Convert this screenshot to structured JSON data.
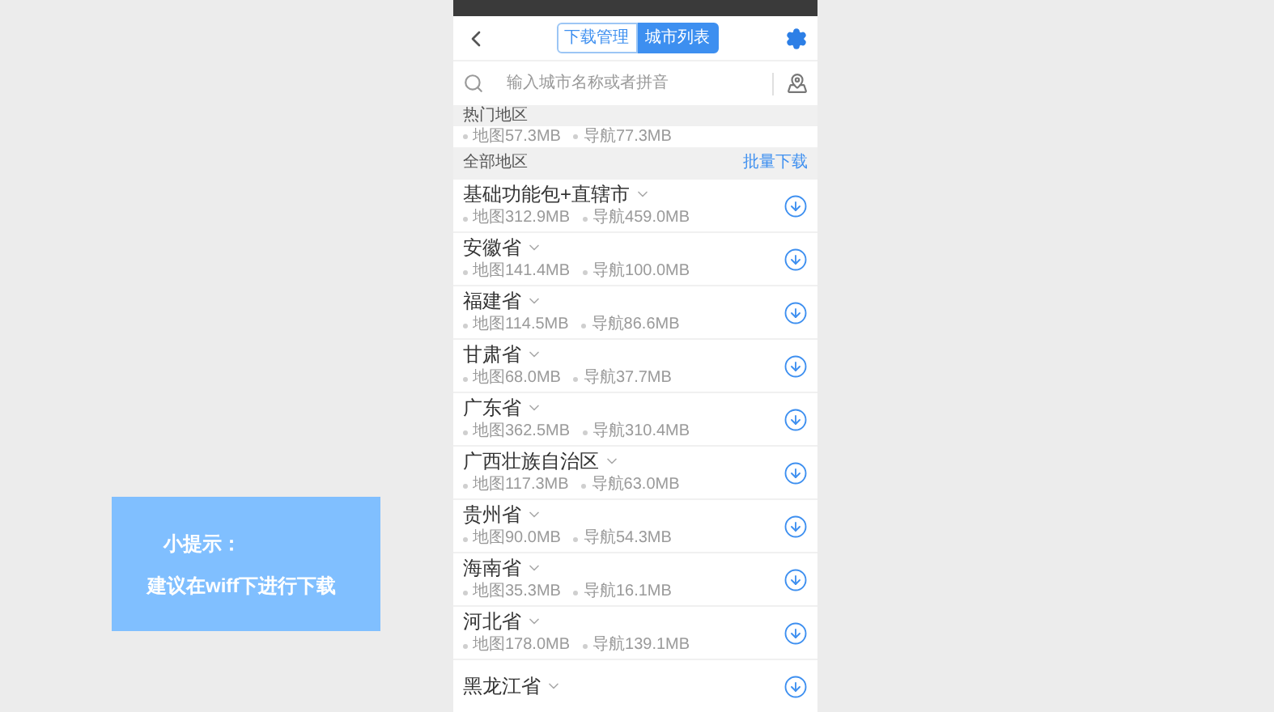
{
  "header": {
    "tabs": [
      {
        "label": "下载管理",
        "selected": false
      },
      {
        "label": "城市列表",
        "selected": true
      }
    ]
  },
  "search": {
    "placeholder": "输入城市名称或者拼音"
  },
  "hot_section": {
    "title": "热门地区",
    "partial_row": {
      "map_size": "地图57.3MB",
      "nav_size": "导航77.3MB"
    }
  },
  "all_section": {
    "title": "全部地区",
    "action": "批量下载"
  },
  "regions": [
    {
      "name": "基础功能包+直辖市",
      "map_size": "地图312.9MB",
      "nav_size": "导航459.0MB"
    },
    {
      "name": "安徽省",
      "map_size": "地图141.4MB",
      "nav_size": "导航100.0MB"
    },
    {
      "name": "福建省",
      "map_size": "地图114.5MB",
      "nav_size": "导航86.6MB"
    },
    {
      "name": "甘肃省",
      "map_size": "地图68.0MB",
      "nav_size": "导航37.7MB"
    },
    {
      "name": "广东省",
      "map_size": "地图362.5MB",
      "nav_size": "导航310.4MB"
    },
    {
      "name": "广西壮族自治区",
      "map_size": "地图117.3MB",
      "nav_size": "导航63.0MB"
    },
    {
      "name": "贵州省",
      "map_size": "地图90.0MB",
      "nav_size": "导航54.3MB"
    },
    {
      "name": "海南省",
      "map_size": "地图35.3MB",
      "nav_size": "导航16.1MB"
    },
    {
      "name": "河北省",
      "map_size": "地图178.0MB",
      "nav_size": "导航139.1MB"
    },
    {
      "name": "黑龙江省"
    }
  ],
  "caption": {
    "title": "小提示：",
    "text": "建议在wiff下进行下载"
  }
}
